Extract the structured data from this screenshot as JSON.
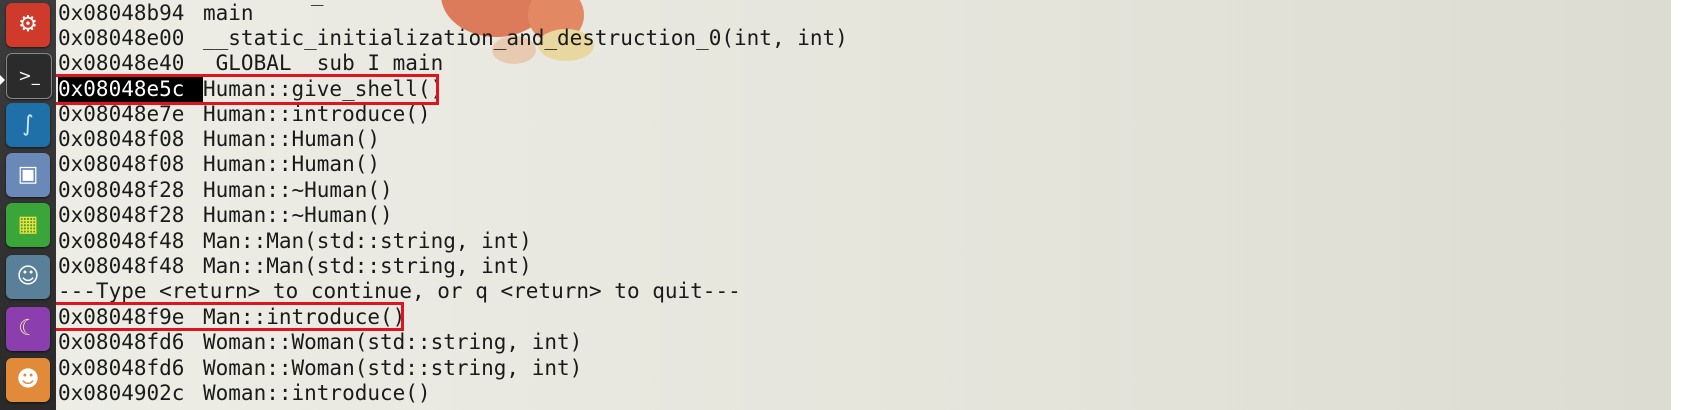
{
  "launcher": {
    "icons": [
      {
        "name": "system-settings-icon",
        "glyph": "⚙",
        "color": "#d03a2a"
      },
      {
        "name": "terminal-icon",
        "glyph": ">_",
        "color": "#2b2b2b"
      },
      {
        "name": "wireshark-icon",
        "glyph": "∫",
        "color": "#1f6fa8"
      },
      {
        "name": "disk-utility-icon",
        "glyph": "▣",
        "color": "#6a88b8"
      },
      {
        "name": "rubiks-cube-game-icon",
        "glyph": "▦",
        "color": "#3aa63a"
      },
      {
        "name": "linux-tux-icon",
        "glyph": "☺",
        "color": "#5a7f98"
      },
      {
        "name": "screensaver-moon-icon",
        "glyph": "☾",
        "color": "#8b3fae"
      },
      {
        "name": "user-avatar-icon",
        "glyph": "☻",
        "color": "#e08a3a"
      }
    ]
  },
  "terminal": {
    "lines": [
      {
        "addr": "0x08048b94",
        "sym": "main"
      },
      {
        "addr": "0x08048e00",
        "sym": "__static_initialization_and_destruction_0(int, int)"
      },
      {
        "addr": "0x08048e40",
        "sym": "_GLOBAL__sub_I_main"
      },
      {
        "addr": "0x08048e5c",
        "sym": "Human::give_shell()"
      },
      {
        "addr": "0x08048e7e",
        "sym": "Human::introduce()"
      },
      {
        "addr": "0x08048f08",
        "sym": "Human::Human()"
      },
      {
        "addr": "0x08048f08",
        "sym": "Human::Human()"
      },
      {
        "addr": "0x08048f28",
        "sym": "Human::~Human()"
      },
      {
        "addr": "0x08048f28",
        "sym": "Human::~Human()"
      },
      {
        "addr": "0x08048f48",
        "sym": "Man::Man(std::string, int)"
      },
      {
        "addr": "0x08048f48",
        "sym": "Man::Man(std::string, int)"
      },
      {
        "text": "---Type <return> to continue, or q <return> to quit---"
      },
      {
        "addr": "0x08048f9e",
        "sym": "Man::introduce()"
      },
      {
        "addr": "0x08048fd6",
        "sym": "Woman::Woman(std::string, int)"
      },
      {
        "addr": "0x08048fd6",
        "sym": "Woman::Woman(std::string, int)"
      },
      {
        "addr": "0x0804902c",
        "sym": "Woman::introduce()"
      }
    ]
  }
}
